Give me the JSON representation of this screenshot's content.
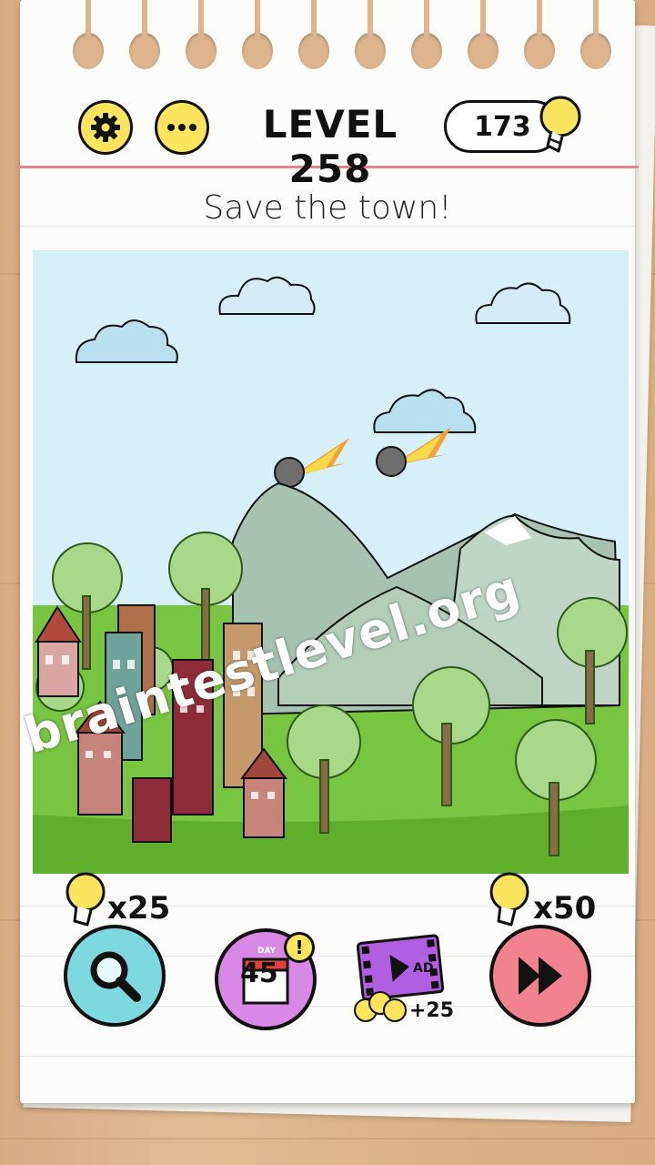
{
  "header": {
    "settings_icon": "gear-icon",
    "menu_icon": "more-dots-icon",
    "level_title": "LEVEL 258",
    "hints_count": "173",
    "hints_icon": "lightbulb-icon"
  },
  "puzzle": {
    "instruction": "Save the town!"
  },
  "watermark": "braintestlevel.org",
  "toolbar": {
    "hint_cost": "x25",
    "skip_cost": "x50",
    "daily_day_label": "DAY",
    "daily_day_number": "45",
    "ad_reward": "+25",
    "ad_label": "AD",
    "daily_badge": "!"
  },
  "colors": {
    "yellow": "#fbe45e",
    "sky": "#d6f0f8",
    "grass": "#77c540",
    "hint_button": "#7ed8df",
    "daily_button": "#d889e6",
    "skip_button": "#f1828e"
  }
}
